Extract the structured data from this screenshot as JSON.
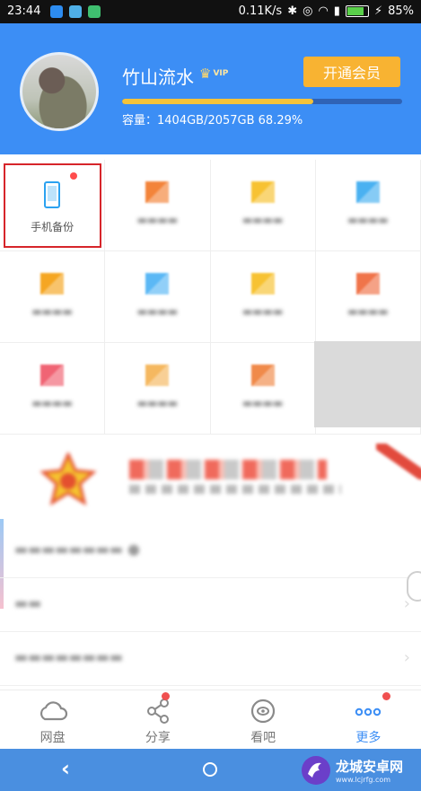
{
  "status_bar": {
    "time": "23:44",
    "speed": "0.11K/s",
    "battery": "85%",
    "battery_level": 0.85
  },
  "header": {
    "username": "竹山流水",
    "vip_label": "VIP",
    "open_member_button": "开通会员",
    "storage_used_fraction": 0.6829,
    "storage_text": "容量：1404GB/2057GB 68.29%"
  },
  "grid": {
    "items": [
      {
        "label": "手机备份",
        "icon": "phone-icon",
        "color": "#2ba2f0",
        "badge": true,
        "clear": true
      },
      {
        "label": "",
        "icon": "blurred-icon",
        "color": "#f3843a"
      },
      {
        "label": "",
        "icon": "blurred-icon",
        "color": "#f7c232"
      },
      {
        "label": "",
        "icon": "blurred-icon",
        "color": "#4ab1f1"
      },
      {
        "label": "",
        "icon": "blurred-icon",
        "color": "#f5a623"
      },
      {
        "label": "",
        "icon": "blurred-icon",
        "color": "#5bb8f5"
      },
      {
        "label": "",
        "icon": "blurred-icon",
        "color": "#f7c232"
      },
      {
        "label": "",
        "icon": "blurred-icon",
        "color": "#f0744a"
      },
      {
        "label": "",
        "icon": "blurred-icon",
        "color": "#f06474"
      },
      {
        "label": "",
        "icon": "blurred-icon",
        "color": "#f5b860"
      },
      {
        "label": "",
        "icon": "blurred-icon",
        "color": "#f08a4a"
      },
      {
        "label": "",
        "icon": "",
        "color": ""
      }
    ]
  },
  "list": {
    "items": [
      {
        "label": ""
      },
      {
        "label": ""
      },
      {
        "label": ""
      }
    ]
  },
  "bottom_nav": {
    "items": [
      {
        "label": "网盘",
        "icon": "cloud-icon"
      },
      {
        "label": "分享",
        "icon": "share-icon",
        "badge": true
      },
      {
        "label": "看吧",
        "icon": "eye-icon"
      },
      {
        "label": "更多",
        "icon": "more-icon",
        "badge": true,
        "active": true
      }
    ]
  },
  "colors": {
    "header_blue": "#3c8ef5",
    "member_button": "#f8b332",
    "progress_fill": "#f5c33a",
    "badge_red": "#f05050"
  },
  "watermark": {
    "title": "龙城安卓网",
    "url": "www.lcjrfg.com"
  }
}
